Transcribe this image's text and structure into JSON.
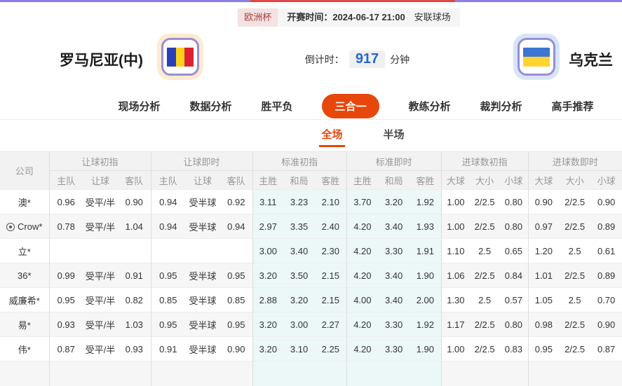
{
  "colors": {
    "accent_orange": "#e8470b",
    "link_blue": "#2767d2",
    "badge_red_text": "#a43d3d",
    "badge_red_bg": "#f4e2e2",
    "strip_purple": "#8a7ee4",
    "strip_red": "#e04747",
    "standard_col_bg": "#ecf8f8",
    "flag_border_purple": "#998ed6",
    "home_glow": "#fcebcf",
    "away_glow": "#d8e5f8"
  },
  "header": {
    "league": "欧洲杯",
    "kickoff": "开赛时间：2024-06-17 21:00",
    "venue": "安联球场",
    "home_team": "罗马尼亚(中)",
    "away_team": "乌克兰",
    "countdown_label": "倒计时：",
    "countdown_value": "917",
    "countdown_unit": "分钟"
  },
  "nav": {
    "tabs": [
      {
        "label": "现场分析",
        "active": false
      },
      {
        "label": "数据分析",
        "active": false
      },
      {
        "label": "胜平负",
        "active": false
      },
      {
        "label": "三合一",
        "active": true
      },
      {
        "label": "教练分析",
        "active": false
      },
      {
        "label": "裁判分析",
        "active": false
      },
      {
        "label": "高手推荐",
        "active": false
      }
    ]
  },
  "subtabs": {
    "tabs": [
      {
        "label": "全场",
        "active": true
      },
      {
        "label": "半场",
        "active": false
      }
    ]
  },
  "table": {
    "company_header": "公司",
    "groups": [
      {
        "label": "让球初指",
        "cols": [
          "主队",
          "让球",
          "客队"
        ]
      },
      {
        "label": "让球即时",
        "cols": [
          "主队",
          "让球",
          "客队"
        ]
      },
      {
        "label": "标准初指",
        "cols": [
          "主胜",
          "和局",
          "客胜"
        ]
      },
      {
        "label": "标准即时",
        "cols": [
          "主胜",
          "和局",
          "客胜"
        ]
      },
      {
        "label": "进球数初指",
        "cols": [
          "大球",
          "大小",
          "小球"
        ]
      },
      {
        "label": "进球数即时",
        "cols": [
          "大球",
          "大小",
          "小球"
        ]
      }
    ],
    "rows": [
      {
        "company": "澳*",
        "icon": null,
        "handicap_initial": [
          "0.96",
          "受平/半",
          "0.90"
        ],
        "handicap_live": [
          "0.94",
          "受半球",
          "0.92"
        ],
        "standard_initial": [
          "3.11",
          "3.23",
          "2.10"
        ],
        "standard_live": [
          "3.70",
          "3.20",
          "1.92"
        ],
        "goals_initial": [
          "1.00",
          "2/2.5",
          "0.80"
        ],
        "goals_live": [
          "0.90",
          "2/2.5",
          "0.90"
        ]
      },
      {
        "company": "Crow*",
        "icon": "target-icon",
        "handicap_initial": [
          "0.78",
          "受平/半",
          "1.04"
        ],
        "handicap_live": [
          "0.94",
          "受半球",
          "0.94"
        ],
        "standard_initial": [
          "2.97",
          "3.35",
          "2.40"
        ],
        "standard_live": [
          "4.20",
          "3.40",
          "1.93"
        ],
        "goals_initial": [
          "1.00",
          "2/2.5",
          "0.80"
        ],
        "goals_live": [
          "0.97",
          "2/2.5",
          "0.89"
        ]
      },
      {
        "company": "立*",
        "icon": null,
        "handicap_initial": [
          "",
          "",
          ""
        ],
        "handicap_live": [
          "",
          "",
          ""
        ],
        "standard_initial": [
          "3.00",
          "3.40",
          "2.30"
        ],
        "standard_live": [
          "4.20",
          "3.30",
          "1.91"
        ],
        "goals_initial": [
          "1.10",
          "2.5",
          "0.65"
        ],
        "goals_live": [
          "1.20",
          "2.5",
          "0.61"
        ]
      },
      {
        "company": "36*",
        "icon": null,
        "handicap_initial": [
          "0.99",
          "受平/半",
          "0.91"
        ],
        "handicap_live": [
          "0.95",
          "受半球",
          "0.95"
        ],
        "standard_initial": [
          "3.20",
          "3.50",
          "2.15"
        ],
        "standard_live": [
          "4.20",
          "3.40",
          "1.90"
        ],
        "goals_initial": [
          "1.06",
          "2/2.5",
          "0.84"
        ],
        "goals_live": [
          "1.01",
          "2/2.5",
          "0.89"
        ]
      },
      {
        "company": "威廉希*",
        "icon": null,
        "handicap_initial": [
          "0.95",
          "受平/半",
          "0.82"
        ],
        "handicap_live": [
          "0.85",
          "受半球",
          "0.85"
        ],
        "standard_initial": [
          "2.88",
          "3.20",
          "2.15"
        ],
        "standard_live": [
          "4.00",
          "3.40",
          "2.00"
        ],
        "goals_initial": [
          "1.30",
          "2.5",
          "0.57"
        ],
        "goals_live": [
          "1.05",
          "2.5",
          "0.70"
        ]
      },
      {
        "company": "易*",
        "icon": null,
        "handicap_initial": [
          "0.93",
          "受平/半",
          "1.03"
        ],
        "handicap_live": [
          "0.95",
          "受半球",
          "0.95"
        ],
        "standard_initial": [
          "3.20",
          "3.00",
          "2.27"
        ],
        "standard_live": [
          "4.20",
          "3.30",
          "1.92"
        ],
        "goals_initial": [
          "1.17",
          "2/2.5",
          "0.80"
        ],
        "goals_live": [
          "0.98",
          "2/2.5",
          "0.90"
        ]
      },
      {
        "company": "伟*",
        "icon": null,
        "handicap_initial": [
          "0.87",
          "受平/半",
          "0.93"
        ],
        "handicap_live": [
          "0.91",
          "受半球",
          "0.90"
        ],
        "standard_initial": [
          "3.20",
          "3.10",
          "2.25"
        ],
        "standard_live": [
          "4.20",
          "3.30",
          "1.90"
        ],
        "goals_initial": [
          "1.00",
          "2/2.5",
          "0.83"
        ],
        "goals_live": [
          "0.95",
          "2/2.5",
          "0.87"
        ]
      }
    ]
  }
}
